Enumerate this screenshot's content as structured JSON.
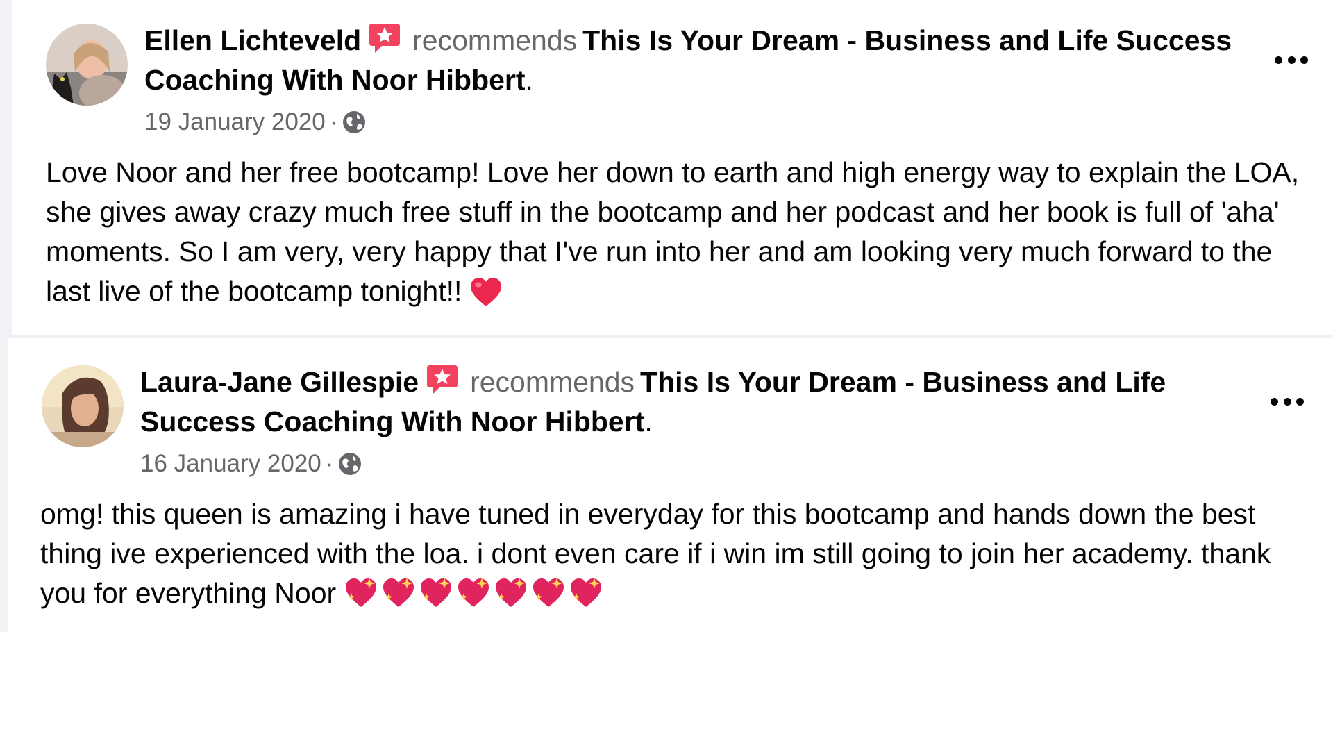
{
  "reviews": [
    {
      "author": "Ellen Lichteveld",
      "verb": "recommends",
      "page": "This Is Your Dream - Business and Life Success Coaching With Noor Hibbert",
      "period": ".",
      "date": "19 January 2020",
      "separator": "·",
      "privacy_icon": "globe-icon",
      "body": "Love Noor and her free bootcamp! Love her down to earth and high energy way to explain the LOA, she gives away crazy much free stuff in the bootcamp and her podcast and her book is full of 'aha' moments. So I am very, very happy that I've run into her and am looking very much forward to the last live of the bootcamp tonight!!",
      "emoji": [
        "red-heart-icon"
      ]
    },
    {
      "author": "Laura-Jane Gillespie",
      "verb": "recommends",
      "page": "This Is Your Dream - Business and Life Success Coaching With Noor Hibbert",
      "period": ".",
      "date": "16 January 2020",
      "separator": "·",
      "privacy_icon": "globe-icon",
      "body": "omg! this queen is amazing i have tuned in everyday for this bootcamp and hands down the best thing ive experienced with the loa. i dont even care if i win im still going to join her academy. thank you for everything Noor",
      "emoji": [
        "sparkling-heart-icon",
        "sparkling-heart-icon",
        "sparkling-heart-icon",
        "sparkling-heart-icon",
        "sparkling-heart-icon",
        "sparkling-heart-icon",
        "sparkling-heart-icon"
      ]
    }
  ],
  "colors": {
    "background": "#f0f2f5",
    "card": "#ffffff",
    "primary_text": "#050505",
    "secondary_text": "#65676b",
    "recommend_badge": "#f3425f",
    "heart": "#e0245e"
  }
}
